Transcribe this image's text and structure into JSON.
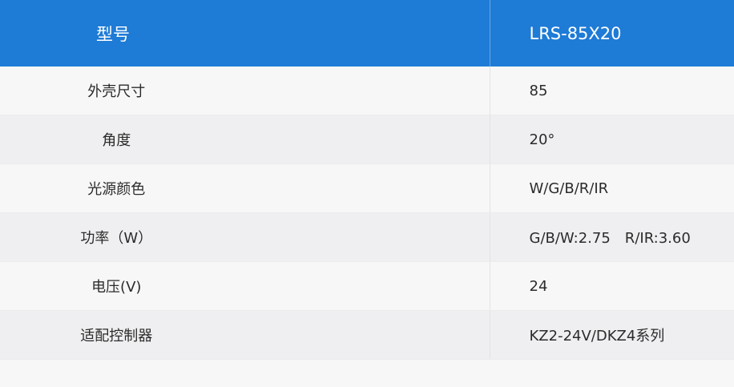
{
  "table": {
    "header": {
      "label": "型号",
      "value": "LRS-85X20"
    },
    "rows": [
      {
        "label": "外壳尺寸",
        "value": "85"
      },
      {
        "label": "角度",
        "value": "20°"
      },
      {
        "label": "光源颜色",
        "value": "W/G/B/R/IR"
      },
      {
        "label": "功率（W）",
        "value": "G/B/W:2.75　R/IR:3.60"
      },
      {
        "label": "电压(V)",
        "value": "24"
      },
      {
        "label": "适配控制器",
        "value": "KZ2-24V/DKZ4系列"
      }
    ]
  },
  "colors": {
    "header_bg": "#1e7bd6",
    "row_odd": "#f7f7f7",
    "row_even": "#efeff1"
  }
}
